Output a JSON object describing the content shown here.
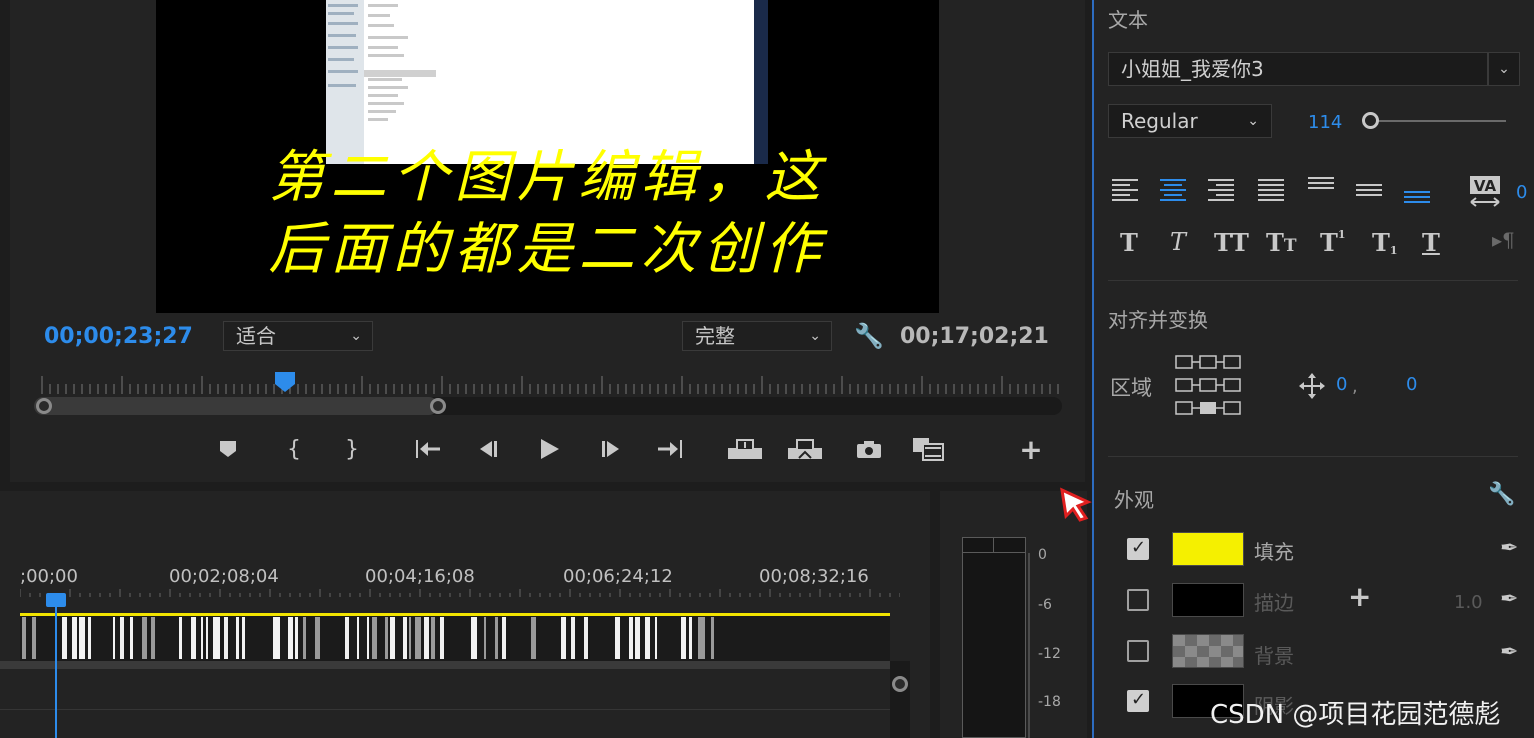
{
  "monitor": {
    "subtitle_line1": "第二个图片编辑，这",
    "subtitle_line2": "后面的都是二次创作",
    "timecode_current": "00;00;23;27",
    "timecode_duration": "00;17;02;21",
    "fit_dropdown": "适合",
    "quality_dropdown": "完整"
  },
  "timeline": {
    "ruler_labels": [
      ";00;00",
      "00;02;08;04",
      "00;04;16;08",
      "00;06;24;12",
      "00;08;32;16"
    ]
  },
  "meter": {
    "db_labels": [
      "0",
      "-6",
      "-12",
      "-18"
    ]
  },
  "panel": {
    "text_section": "文本",
    "font_name": "小姐姐_我爱你3",
    "font_style": "Regular",
    "font_size": "114",
    "tracking_value": "0",
    "align_section": "对齐并变换",
    "area_label": "区域",
    "pos_x": "0",
    "pos_sep": ",",
    "pos_y": "0",
    "appearance_section": "外观",
    "fill_label": "填充",
    "stroke_label": "描边",
    "stroke_width": "1.0",
    "background_label": "背景",
    "shadow_label": "阴影",
    "fill_color": "#f5f000",
    "stroke_color": "#000000"
  },
  "watermark": "CSDN @项目花园范德彪"
}
